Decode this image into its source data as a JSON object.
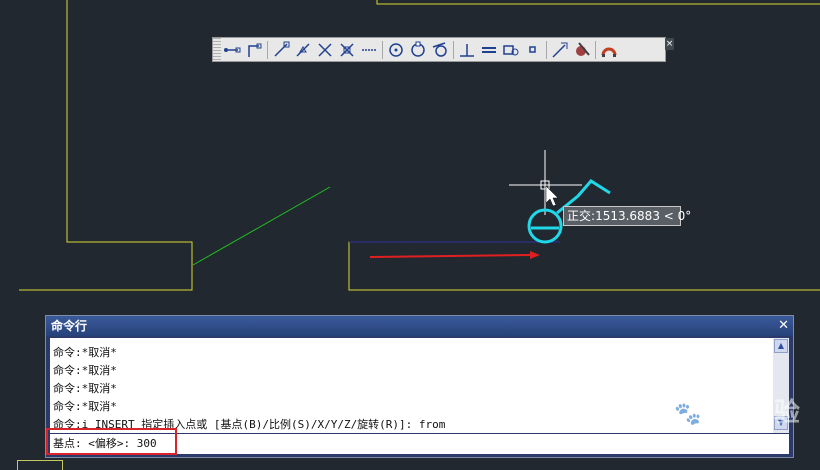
{
  "tooltip": {
    "label": "正交",
    "value": "1513.6883 < 0°"
  },
  "toolbar": {
    "tools": [
      "temp-track-point-icon",
      "snap-from-icon",
      "endpoint-icon",
      "midpoint-icon",
      "intersection-icon",
      "apparent-intersection-icon",
      "extension-icon",
      "center-icon",
      "quadrant-icon",
      "tangent-icon",
      "perpendicular-icon",
      "parallel-icon",
      "insert-point-icon",
      "node-icon",
      "nearest-icon",
      "none-icon",
      "osnap-settings-icon"
    ]
  },
  "command_window": {
    "title": "命令行",
    "history": [
      "命令:*取消*",
      "命令:*取消*",
      "命令:*取消*",
      "命令:*取消*",
      "命令:i INSERT 指定插入点或 [基点(B)/比例(S)/X/Y/Z/旋转(R)]: from"
    ],
    "prompt": "基点: <偏移>: 300"
  },
  "colors": {
    "background": "#212830",
    "wall": "#d8d830",
    "cyan": "#20d8e8",
    "green": "#20c020",
    "red": "#e02020",
    "highlight": "#d8232a"
  }
}
